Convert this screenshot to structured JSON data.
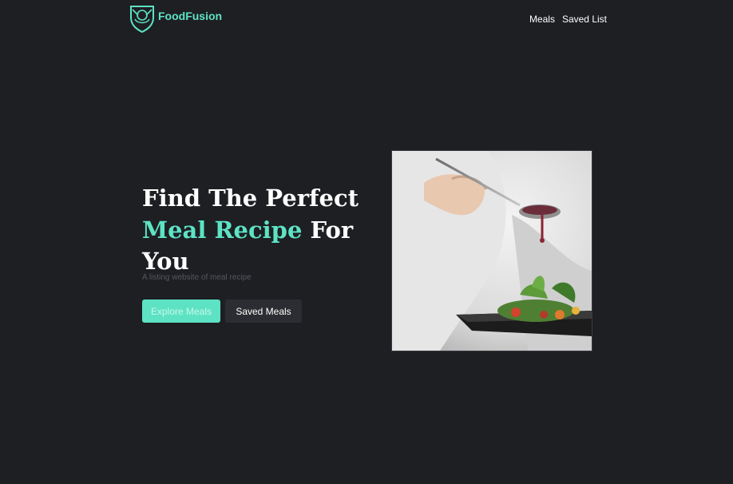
{
  "brand": {
    "name": "FoodFusion",
    "accent_color": "#5de3c4"
  },
  "nav": {
    "items": [
      {
        "label": "Meals"
      },
      {
        "label": "Saved List"
      }
    ]
  },
  "hero": {
    "title_part1": "Find The Perfect",
    "title_accent": "Meal Recipe",
    "title_part2": "For You",
    "subtitle": "A listing website of meal recipe",
    "primary_button": "Explore Meals",
    "secondary_button": "Saved Meals",
    "image_icon": "chef-plating-dish-image"
  },
  "colors": {
    "background": "#1e1f23",
    "secondary_button_bg": "#2c2d32"
  }
}
